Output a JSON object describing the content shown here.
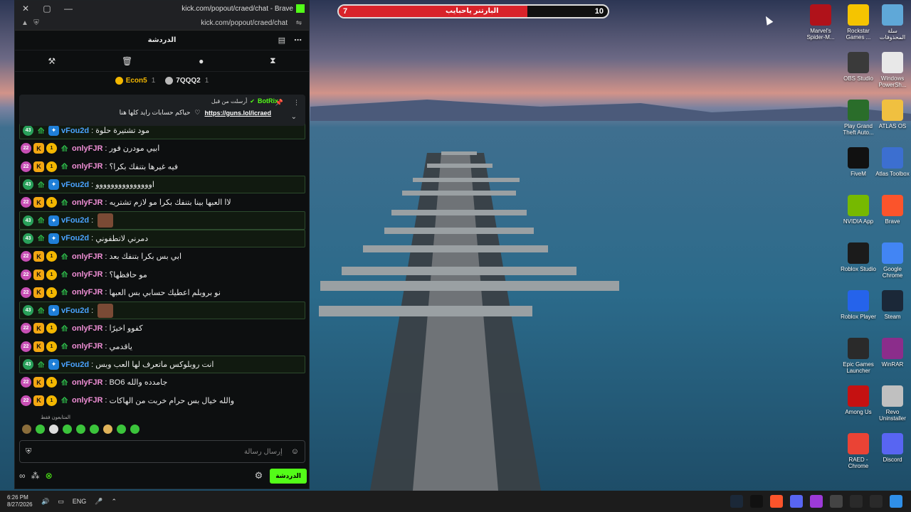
{
  "browser": {
    "title": "kick.com/popout/craed/chat - Brave",
    "url": "kick.com/popout/craed/chat",
    "controls": [
      "✕",
      "▢",
      "—"
    ]
  },
  "chat": {
    "header_title": "الدردشة",
    "leaderboard": [
      {
        "name": "Econ5",
        "count": "1",
        "color": "#f3b700"
      },
      {
        "name": "7QQQ2",
        "count": "1",
        "color": "#b9b9b9"
      }
    ],
    "pinned": {
      "label": "أرسلت من قبل",
      "bot_name": "BotRix",
      "text": "حياكم حسابات رايد كلها هنا",
      "link": "https://guns.lol/icraed"
    },
    "messages": [
      {
        "user": "vFou2d",
        "text": "مود تشتيرة حلوة",
        "sub": "43",
        "hl": true,
        "color": "blue"
      },
      {
        "user": "onlyFJR",
        "text": "ابيي مودرن فور",
        "sub": "22",
        "hl": false,
        "color": "pink"
      },
      {
        "user": "onlyFJR",
        "text": "فيه غيرها بتنفك بكرا؟",
        "sub": "22",
        "hl": false,
        "color": "pink"
      },
      {
        "user": "vFou2d",
        "text": "اووووووووووووووو",
        "sub": "43",
        "hl": true,
        "color": "blue"
      },
      {
        "user": "onlyFJR",
        "text": "لاا العبها بينا بتنفك بكرا مو لازم تشتريه",
        "sub": "22",
        "hl": false,
        "color": "pink"
      },
      {
        "user": "vFou2d",
        "text": "",
        "sub": "43",
        "hl": true,
        "color": "blue"
      },
      {
        "user": "vFou2d",
        "text": "دمرني لاتطفوني",
        "sub": "43",
        "hl": true,
        "color": "blue"
      },
      {
        "user": "onlyFJR",
        "text": "ابي بس بكرا بتنفك بعد",
        "sub": "22",
        "hl": false,
        "color": "pink"
      },
      {
        "user": "onlyFJR",
        "text": "مو حافظها؟",
        "sub": "22",
        "hl": false,
        "color": "pink"
      },
      {
        "user": "onlyFJR",
        "text": "نو بروبلم اعطيك حسابي بس العبها",
        "sub": "22",
        "hl": false,
        "color": "pink"
      },
      {
        "user": "vFou2d",
        "text": "",
        "sub": "43",
        "hl": true,
        "color": "blue"
      },
      {
        "user": "onlyFJR",
        "text": "كفوو اخيرًا",
        "sub": "22",
        "hl": false,
        "color": "pink"
      },
      {
        "user": "onlyFJR",
        "text": "ياقدمي",
        "sub": "22",
        "hl": false,
        "color": "pink"
      },
      {
        "user": "vFou2d",
        "text": "انت روبلوكس ماتعرف لها العب وبس",
        "sub": "43",
        "hl": true,
        "color": "blue"
      },
      {
        "user": "onlyFJR",
        "text": "جامدده والله BO6",
        "sub": "22",
        "hl": false,
        "color": "pink"
      },
      {
        "user": "onlyFJR",
        "text": "والله خيال بس حرام خربت من الهاكات",
        "sub": "22",
        "hl": false,
        "color": "pink"
      }
    ],
    "emote_section_label": "المتابعون فقط",
    "composer_placeholder": "إرسال رسالة",
    "send_label": "الدردشة"
  },
  "poll": {
    "left_value": "7",
    "right_value": "10",
    "title": "البارتنر ياحبايب",
    "fill_fraction": 0.7
  },
  "desktop_icons": [
    {
      "label": "Marvel's Spider-M...",
      "color": "#b0121a"
    },
    {
      "label": "Rockstar Games ...",
      "color": "#f5c400"
    },
    {
      "label": "سلة المحذوفات",
      "color": "#5fa8d8"
    },
    {
      "label": "OBS Studio",
      "color": "#3a3a3a"
    },
    {
      "label": "Windows PowerSh...",
      "color": "#e8e8e8"
    },
    {
      "label": "Play Grand Theft Auto...",
      "color": "#2a6d2a"
    },
    {
      "label": "ATLAS OS",
      "color": "#f0c040"
    },
    {
      "label": "FiveM",
      "color": "#111111"
    },
    {
      "label": "Atlas Toolbox",
      "color": "#3c6fd0"
    },
    {
      "label": "NVIDIA App",
      "color": "#76b900"
    },
    {
      "label": "Brave",
      "color": "#fb542b"
    },
    {
      "label": "Roblox Studio",
      "color": "#1b1b1b"
    },
    {
      "label": "Google Chrome",
      "color": "#4285f4"
    },
    {
      "label": "Roblox Player",
      "color": "#2563eb"
    },
    {
      "label": "Steam",
      "color": "#1b2838"
    },
    {
      "label": "Epic Games Launcher",
      "color": "#2a2a2a"
    },
    {
      "label": "WinRAR",
      "color": "#8b2d8b"
    },
    {
      "label": "Among Us",
      "color": "#c51111"
    },
    {
      "label": "Revo Uninstaller",
      "color": "#c0c0c0"
    },
    {
      "label": "RAED - Chrome",
      "color": "#ea4335"
    },
    {
      "label": "Discord",
      "color": "#5865f2"
    }
  ],
  "taskbar": {
    "time": "6:26 PM",
    "date": "8/27/2026",
    "lang": "ENG"
  }
}
